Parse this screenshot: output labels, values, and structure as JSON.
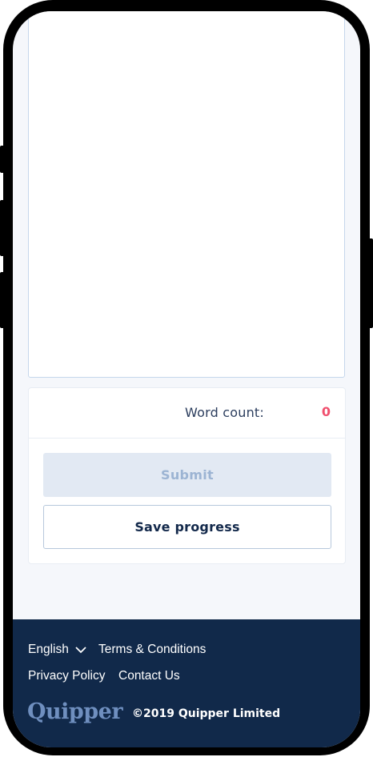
{
  "word_count": {
    "label": "Word count:",
    "value": "0"
  },
  "actions": {
    "submit_label": "Submit",
    "save_label": "Save progress"
  },
  "footer": {
    "language": "English",
    "terms": "Terms & Conditions",
    "privacy": "Privacy Policy",
    "contact": "Contact Us",
    "logo_text": "Quipper",
    "copyright": "©2019 Quipper Limited"
  },
  "colors": {
    "footer_bg": "#11294a",
    "accent_count": "#f0506e",
    "submit_disabled_bg": "#e2e9f3"
  },
  "icons": {
    "language_chevron": "chevron-down-icon"
  }
}
